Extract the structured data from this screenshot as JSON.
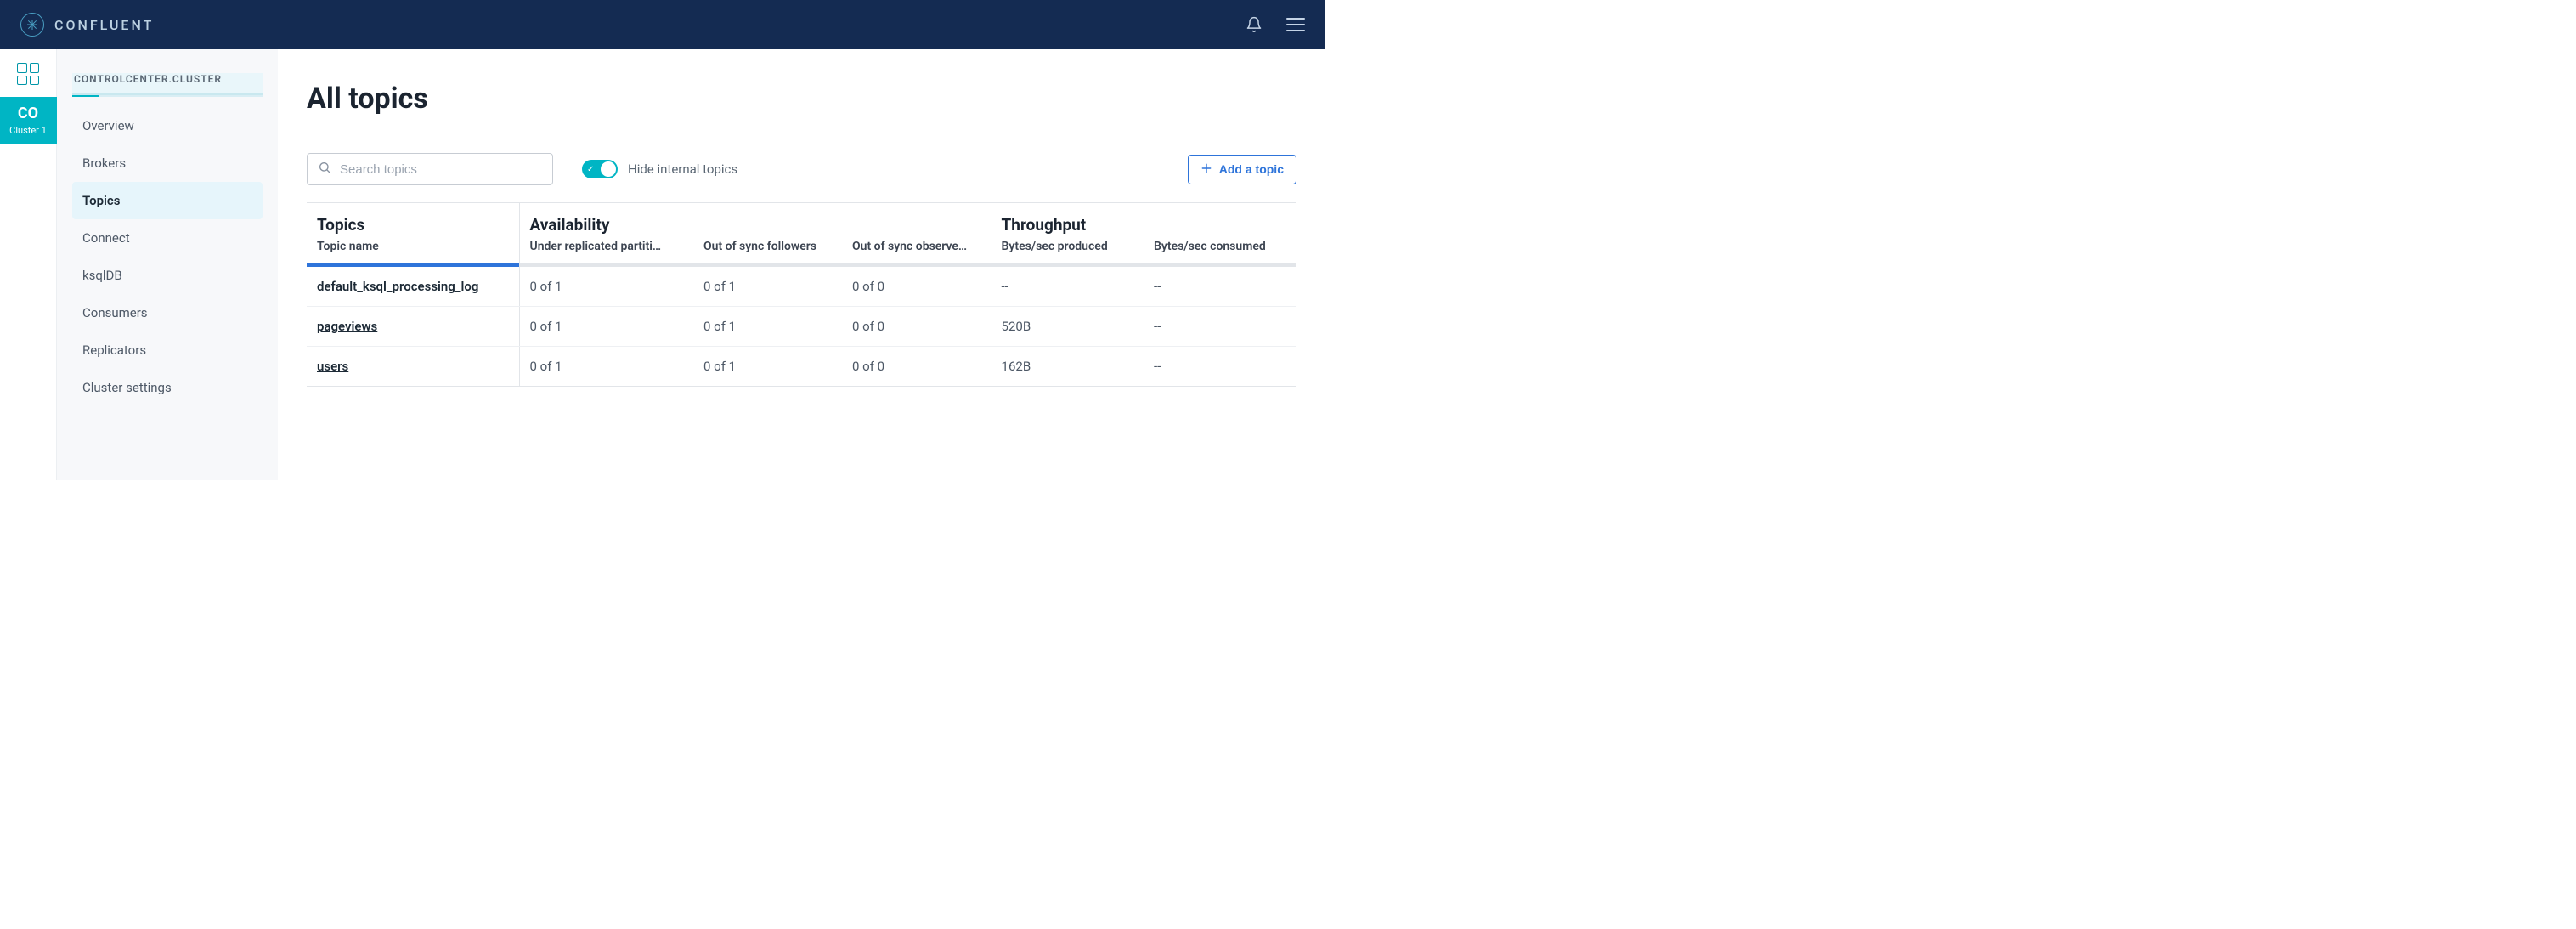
{
  "brand": {
    "name": "CONFLUENT"
  },
  "rail": {
    "cluster_short": "CO",
    "cluster_label": "Cluster 1"
  },
  "sidebar": {
    "cluster_breadcrumb": "CONTROLCENTER.CLUSTER",
    "items": [
      {
        "label": "Overview"
      },
      {
        "label": "Brokers"
      },
      {
        "label": "Topics"
      },
      {
        "label": "Connect"
      },
      {
        "label": "ksqlDB"
      },
      {
        "label": "Consumers"
      },
      {
        "label": "Replicators"
      },
      {
        "label": "Cluster settings"
      }
    ],
    "active_index": 2
  },
  "page": {
    "title": "All topics",
    "search_placeholder": "Search topics",
    "hide_internal_label": "Hide internal topics",
    "add_button_label": "Add a topic"
  },
  "table": {
    "groups": {
      "topics": "Topics",
      "availability": "Availability",
      "throughput": "Throughput"
    },
    "columns": {
      "name": "Topic name",
      "under_replicated": "Under replicated partiti…",
      "out_of_sync_followers": "Out of sync followers",
      "out_of_sync_observers": "Out of sync observe…",
      "bytes_produced": "Bytes/sec produced",
      "bytes_consumed": "Bytes/sec consumed"
    },
    "rows": [
      {
        "name": "default_ksql_processing_log",
        "under_replicated": "0 of 1",
        "oos_followers": "0 of 1",
        "oos_observers": "0 of 0",
        "produced": "--",
        "consumed": "--"
      },
      {
        "name": "pageviews",
        "under_replicated": "0 of 1",
        "oos_followers": "0 of 1",
        "oos_observers": "0 of 0",
        "produced": "520B",
        "consumed": "--"
      },
      {
        "name": "users",
        "under_replicated": "0 of 1",
        "oos_followers": "0 of 1",
        "oos_observers": "0 of 0",
        "produced": "162B",
        "consumed": "--"
      }
    ]
  }
}
